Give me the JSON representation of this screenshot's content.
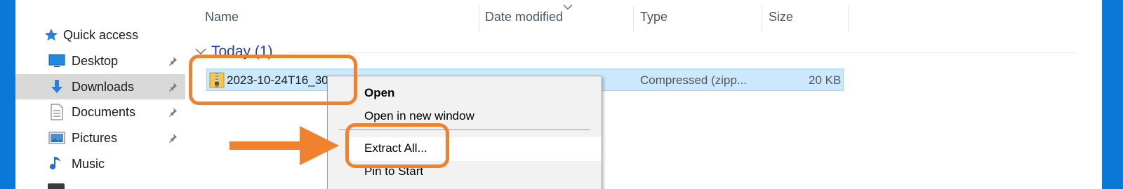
{
  "sidebar": {
    "items": [
      {
        "label": "Quick access",
        "icon": "star-icon",
        "pinned": false,
        "selected": false
      },
      {
        "label": "Desktop",
        "icon": "desktop-icon",
        "pinned": true,
        "selected": false
      },
      {
        "label": "Downloads",
        "icon": "download-arrow-icon",
        "pinned": true,
        "selected": true
      },
      {
        "label": "Documents",
        "icon": "documents-icon",
        "pinned": true,
        "selected": false
      },
      {
        "label": "Pictures",
        "icon": "pictures-icon",
        "pinned": true,
        "selected": false
      },
      {
        "label": "Music",
        "icon": "music-icon",
        "pinned": false,
        "selected": false
      }
    ]
  },
  "columns": {
    "name": "Name",
    "date_modified": "Date modified",
    "type": "Type",
    "size": "Size"
  },
  "group": {
    "label": "Today (1)"
  },
  "files": [
    {
      "name": "2023-10-24T16_30",
      "type": "Compressed (zipp...",
      "size": "20 KB",
      "icon": "zip-folder-icon",
      "selected": true
    }
  ],
  "context_menu": {
    "items": [
      "Open",
      "Open in new window",
      "Extract All...",
      "Pin to Start"
    ],
    "hovered": "Extract All..."
  },
  "annotation": {
    "color": "#f0812f"
  },
  "colors": {
    "selection_bg": "#cce8ff",
    "group_header": "#1e3fa3",
    "background_edge": "#0b78d7"
  }
}
